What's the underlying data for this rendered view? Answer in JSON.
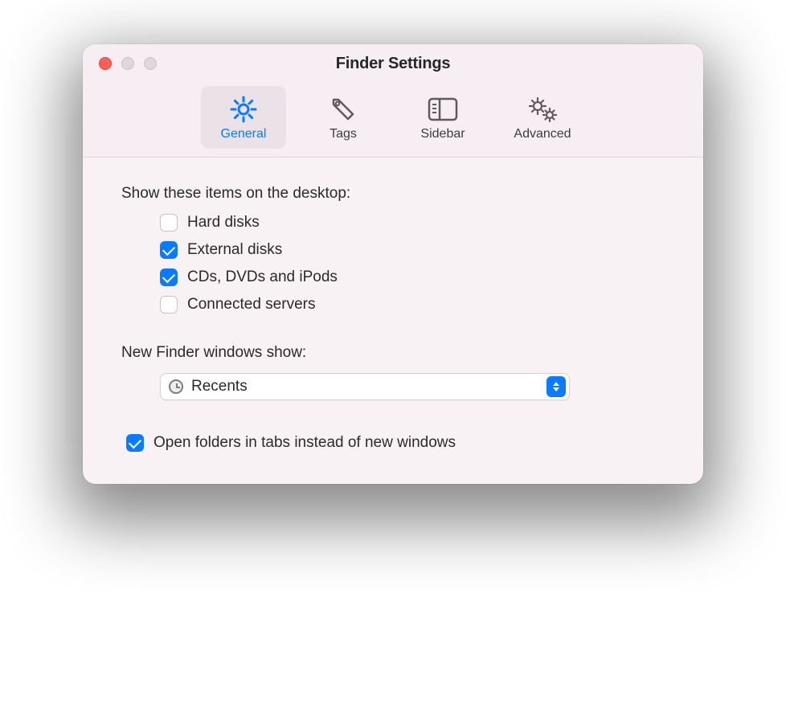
{
  "window": {
    "title": "Finder Settings"
  },
  "tabs": [
    {
      "id": "general",
      "label": "General",
      "active": true
    },
    {
      "id": "tags",
      "label": "Tags",
      "active": false
    },
    {
      "id": "sidebar",
      "label": "Sidebar",
      "active": false
    },
    {
      "id": "advanced",
      "label": "Advanced",
      "active": false
    }
  ],
  "desktop": {
    "heading": "Show these items on the desktop:",
    "items": [
      {
        "label": "Hard disks",
        "checked": false
      },
      {
        "label": "External disks",
        "checked": true
      },
      {
        "label": "CDs, DVDs and iPods",
        "checked": true
      },
      {
        "label": "Connected servers",
        "checked": false
      }
    ]
  },
  "newWindow": {
    "heading": "New Finder windows show:",
    "selected": "Recents"
  },
  "tabsOption": {
    "label": "Open folders in tabs instead of new windows",
    "checked": true
  },
  "colors": {
    "accent": "#0a7aff"
  }
}
